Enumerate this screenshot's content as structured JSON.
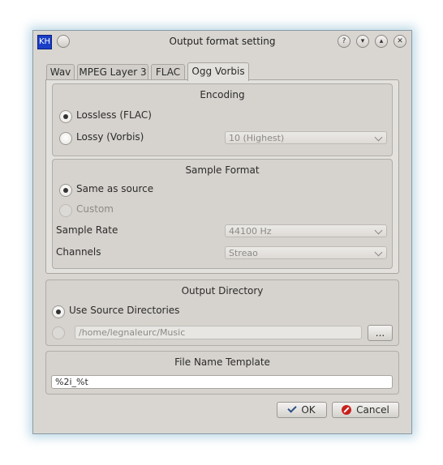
{
  "window": {
    "title": "Output format setting",
    "app_icon_text": "KH",
    "buttons": [
      "?",
      "▾",
      "▴",
      "✕"
    ]
  },
  "tabs": [
    {
      "label": "Wav",
      "active": false
    },
    {
      "label": "MPEG Layer 3",
      "active": false
    },
    {
      "label": "FLAC",
      "active": false
    },
    {
      "label": "Ogg Vorbis",
      "active": true
    }
  ],
  "encoding": {
    "title": "Encoding",
    "lossless_label": "Lossless (FLAC)",
    "lossless_checked": true,
    "lossy_label": "Lossy (Vorbis)",
    "quality_value": "10 (Highest)"
  },
  "sample_format": {
    "title": "Sample Format",
    "same_as_source_label": "Same as source",
    "custom_label": "Custom",
    "sample_rate_label": "Sample Rate",
    "sample_rate_value": "44100 Hz",
    "channels_label": "Channels",
    "channels_value": "Streao"
  },
  "output_directory": {
    "title": "Output Directory",
    "use_source_label": "Use Source Directories",
    "path_value": "/home/legnaleurc/Music",
    "browse_label": "..."
  },
  "file_name_template": {
    "title": "File Name Template",
    "value": "%2i_%t"
  },
  "footer": {
    "ok_label": "OK",
    "cancel_label": "Cancel"
  },
  "colors": {
    "window_bg": "#d9d6d1",
    "app_icon_bg": "#1a3fc7",
    "cancel_icon": "#c8201c"
  }
}
